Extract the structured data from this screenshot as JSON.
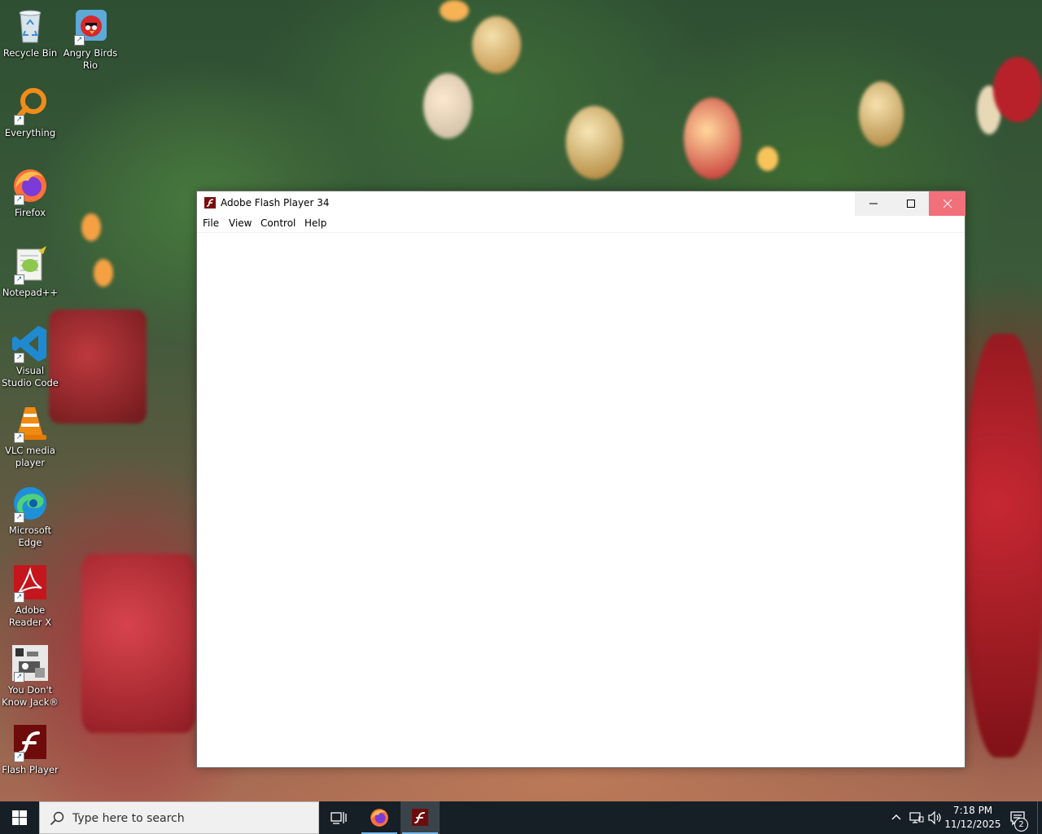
{
  "desktop": {
    "icons": [
      {
        "label": "Recycle Bin",
        "icon": "recycle-bin-icon",
        "shortcut": false
      },
      {
        "label": "Angry Birds Rio",
        "icon": "angry-birds-icon",
        "shortcut": true
      },
      {
        "label": "Everything",
        "icon": "everything-search-icon",
        "shortcut": true
      },
      {
        "label": "Firefox",
        "icon": "firefox-icon",
        "shortcut": true
      },
      {
        "label": "Notepad++",
        "icon": "notepad-plus-plus-icon",
        "shortcut": true
      },
      {
        "label": "Visual Studio Code",
        "icon": "vscode-icon",
        "shortcut": true
      },
      {
        "label": "VLC media player",
        "icon": "vlc-icon",
        "shortcut": true
      },
      {
        "label": "Microsoft Edge",
        "icon": "edge-icon",
        "shortcut": true
      },
      {
        "label": "Adobe Reader X",
        "icon": "adobe-reader-icon",
        "shortcut": true
      },
      {
        "label": "You Don't Know Jack®",
        "icon": "you-dont-know-jack-icon",
        "shortcut": true
      },
      {
        "label": "Flash Player",
        "icon": "flash-player-icon",
        "shortcut": true
      }
    ]
  },
  "window": {
    "title": "Adobe Flash Player 34",
    "icon": "flash-player-icon",
    "menu": [
      "File",
      "View",
      "Control",
      "Help"
    ],
    "controls": {
      "minimize": "minimize-icon",
      "maximize": "maximize-icon",
      "close": "close-icon"
    },
    "colors": {
      "close_hover": "#f1707a"
    }
  },
  "taskbar": {
    "search_placeholder": "Type here to search",
    "apps": [
      {
        "name": "Task View",
        "icon": "task-view-icon",
        "active": false
      },
      {
        "name": "Firefox",
        "icon": "firefox-icon",
        "active": true
      },
      {
        "name": "Adobe Flash Player",
        "icon": "flash-player-icon",
        "active": true
      }
    ],
    "time": "7:18 PM",
    "date": "11/12/2025",
    "notification_count": "2",
    "colors": {
      "background": "#161e26",
      "active_underline": "#76b9ed"
    }
  }
}
